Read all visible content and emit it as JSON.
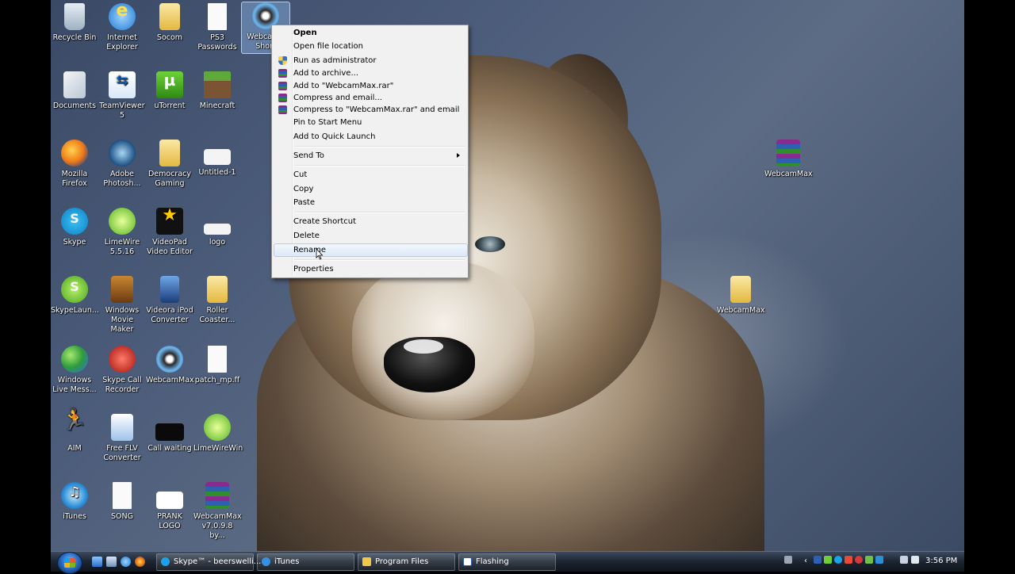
{
  "desktop": {
    "icons": [
      {
        "label": "Recycle Bin",
        "icon": "recycle-bin-icon"
      },
      {
        "label": "Internet Explorer",
        "icon": "internet-explorer-icon"
      },
      {
        "label": "Socom",
        "icon": "folder-icon"
      },
      {
        "label": "PS3 Passwords",
        "icon": "text-file-icon"
      },
      {
        "label": "Webcam - Short",
        "icon": "webcam-icon"
      },
      {
        "label": "Documents",
        "icon": "documents-icon"
      },
      {
        "label": "TeamViewer 5",
        "icon": "teamviewer-icon"
      },
      {
        "label": "uTorrent",
        "icon": "utorrent-icon"
      },
      {
        "label": "Minecraft",
        "icon": "minecraft-icon"
      },
      {
        "label": "Mozilla Firefox",
        "icon": "firefox-icon"
      },
      {
        "label": "Adobe Photosh...",
        "icon": "photoshop-icon"
      },
      {
        "label": "Democracy Gaming",
        "icon": "folder-icon"
      },
      {
        "label": "Untitled-1",
        "icon": "image-file-icon"
      },
      {
        "label": "Skype",
        "icon": "skype-icon"
      },
      {
        "label": "LimeWire 5.5.16",
        "icon": "limewire-icon"
      },
      {
        "label": "VideoPad Video Editor",
        "icon": "videopad-icon"
      },
      {
        "label": "logo",
        "icon": "image-file-icon"
      },
      {
        "label": "SkypeLaun...",
        "icon": "skype-icon"
      },
      {
        "label": "Windows Movie Maker",
        "icon": "movie-maker-icon"
      },
      {
        "label": "Videora iPod Converter",
        "icon": "videora-icon"
      },
      {
        "label": "Roller Coaster...",
        "icon": "folder-icon"
      },
      {
        "label": "Windows Live Mess...",
        "icon": "live-messenger-icon"
      },
      {
        "label": "Skype Call Recorder",
        "icon": "call-recorder-icon"
      },
      {
        "label": "WebcamMax",
        "icon": "webcam-icon"
      },
      {
        "label": "patch_mp.ff",
        "icon": "blank-file-icon"
      },
      {
        "label": "AIM",
        "icon": "aim-icon"
      },
      {
        "label": "Free FLV Converter",
        "icon": "flv-converter-icon"
      },
      {
        "label": "Call waiting",
        "icon": "video-file-icon"
      },
      {
        "label": "LimeWireWin",
        "icon": "limewire-icon"
      },
      {
        "label": "iTunes",
        "icon": "itunes-icon"
      },
      {
        "label": "SONG",
        "icon": "text-file-icon"
      },
      {
        "label": "PRANK LOGO",
        "icon": "image-file-icon"
      },
      {
        "label": "WebcamMax v7.0.9.8 by...",
        "icon": "winrar-icon"
      },
      {
        "label": "WebcamMax",
        "icon": "winrar-icon"
      },
      {
        "label": "WebcamMax",
        "icon": "folder-icon"
      }
    ]
  },
  "context_menu": {
    "items": [
      {
        "label": "Open",
        "bold": true
      },
      {
        "label": "Open file location"
      },
      {
        "label": "Run as administrator",
        "icon": "shield-icon"
      },
      {
        "label": "Add to archive...",
        "icon": "winrar-icon"
      },
      {
        "label": "Add to \"WebcamMax.rar\"",
        "icon": "winrar-icon"
      },
      {
        "label": "Compress and email...",
        "icon": "winrar-icon"
      },
      {
        "label": "Compress to \"WebcamMax.rar\" and email",
        "icon": "winrar-icon"
      },
      {
        "label": "Pin to Start Menu"
      },
      {
        "label": "Add to Quick Launch"
      },
      {
        "label": "Send To",
        "submenu": true
      },
      {
        "label": "Cut"
      },
      {
        "label": "Copy"
      },
      {
        "label": "Paste"
      },
      {
        "label": "Create Shortcut"
      },
      {
        "label": "Delete"
      },
      {
        "label": "Rename",
        "highlighted": true
      },
      {
        "label": "Properties"
      }
    ]
  },
  "taskbar": {
    "buttons": [
      {
        "label": "Skype™ - beerswelli...",
        "icon": "skype-icon"
      },
      {
        "label": "iTunes",
        "icon": "itunes-icon"
      },
      {
        "label": "Program Files",
        "icon": "folder-icon"
      },
      {
        "label": "Flashing",
        "icon": "window-icon"
      }
    ],
    "clock": "3:56 PM"
  },
  "colors": {
    "menu_bg": "#f1f1f1",
    "menu_highlight": "#dce9f8",
    "taskbar": "#1c2430",
    "selection": "#8cb4e6"
  }
}
